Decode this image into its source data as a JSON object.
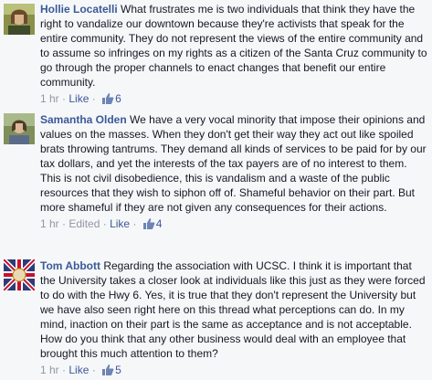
{
  "comments": [
    {
      "author": "Hollie Locatelli",
      "text": "What frustrates me is two individuals that think they have the right to vandalize our downtown because they're activists that speak for the entire community. They do not represent the views of the entire community and to assume so infringes on my rights as a citizen of the Santa Cruz community to go through the proper channels to enact changes that benefit our entire community.",
      "time": "1 hr",
      "sep": "·",
      "edited": "",
      "like_label": "Like",
      "like_count": "6"
    },
    {
      "author": "Samantha Olden",
      "text": "We have a very vocal minority that impose their opinions and values on the masses. When they don't get their way they act out like spoiled brats throwing tantrums. They demand all kinds of services to be paid for by our tax dollars, and yet the interests of the tax payers are of no interest to them. This is not civil disobedience, this is vandalism and a waste of the public resources that they wish to siphon off of. Shameful behavior on their part. But more shameful if they are not given any consequences for their actions.",
      "time": "1 hr",
      "sep": "·",
      "edited": "Edited",
      "like_label": "Like",
      "like_count": "4"
    },
    {
      "author": "Tom Abbott",
      "text": "Regarding the association with UCSC. I think it is important that the University takes a closer look at individuals like this just as they were forced to do with the Hwy 6. Yes, it is true that they don't represent the University but we have also seen right here on this thread what perceptions can do. In my mind, inaction on their part is the same as acceptance and is not acceptable. How do you think that any other business would deal with an employee that brought this much attention to them?",
      "time": "1 hr",
      "sep": "·",
      "edited": "",
      "like_label": "Like",
      "like_count": "5"
    }
  ],
  "icons": {
    "like": "thumbs-up-icon",
    "avatar": "profile-photo"
  },
  "colors": {
    "author": "#3b5998",
    "meta": "#9197a3",
    "background": "#f6f7f9"
  }
}
